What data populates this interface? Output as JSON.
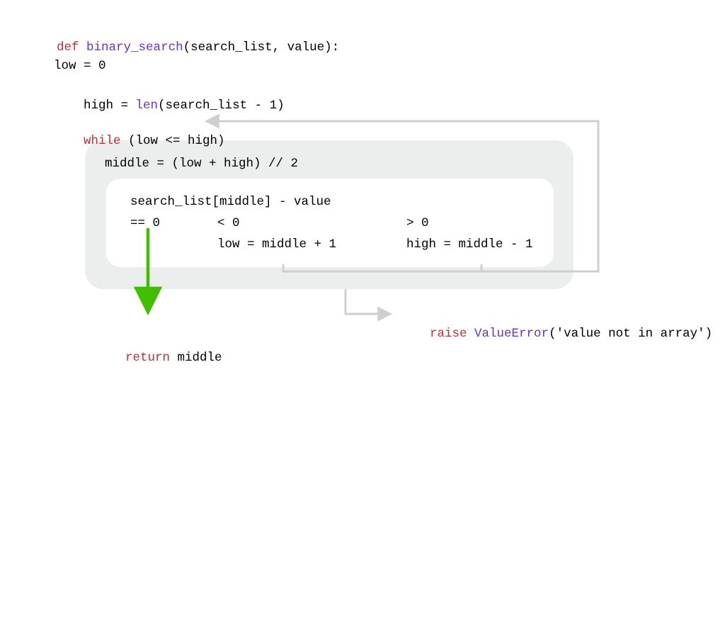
{
  "code": {
    "def": "def",
    "fn_name": "binary_search",
    "params": "(search_list, value):",
    "low_init": "low = 0",
    "high_init": "high = ",
    "len": "len",
    "high_arg": "(search_list - 1)",
    "while_kw": "while",
    "while_cond": " (low <= high)",
    "middle_assign": "middle = (low + high) // 2",
    "compare_expr": "search_list[middle] - value",
    "case_eq": "== 0",
    "case_lt": "< 0",
    "case_gt": "> 0",
    "low_update": "low = middle + 1",
    "high_update": "high = middle - 1",
    "return_kw": "return",
    "return_val": " middle",
    "raise_kw": "raise",
    "err_type": " ValueError",
    "err_msg": "('value not in array')"
  }
}
